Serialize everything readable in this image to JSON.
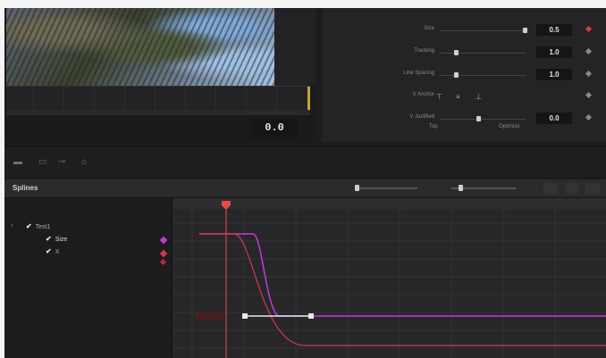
{
  "viewer": {
    "timecode": "0.0"
  },
  "inspector": {
    "rows": [
      {
        "label": "Size",
        "value": "0.5"
      },
      {
        "label": "Tracking",
        "value": "1.0"
      },
      {
        "label": "Line Spacing",
        "value": "1.0"
      },
      {
        "label": "V Anchor",
        "value": ""
      },
      {
        "label": "V Justified",
        "value": "0.0"
      }
    ],
    "sublabels": [
      "Top",
      "Optimize"
    ]
  },
  "splines": {
    "title": "Splines",
    "tree": {
      "root": "Text1",
      "children": [
        "Size",
        "X"
      ]
    }
  },
  "colors": {
    "accent_magenta": "#c23bd6",
    "accent_red": "#d23a4a",
    "playhead": "#e8484c"
  }
}
